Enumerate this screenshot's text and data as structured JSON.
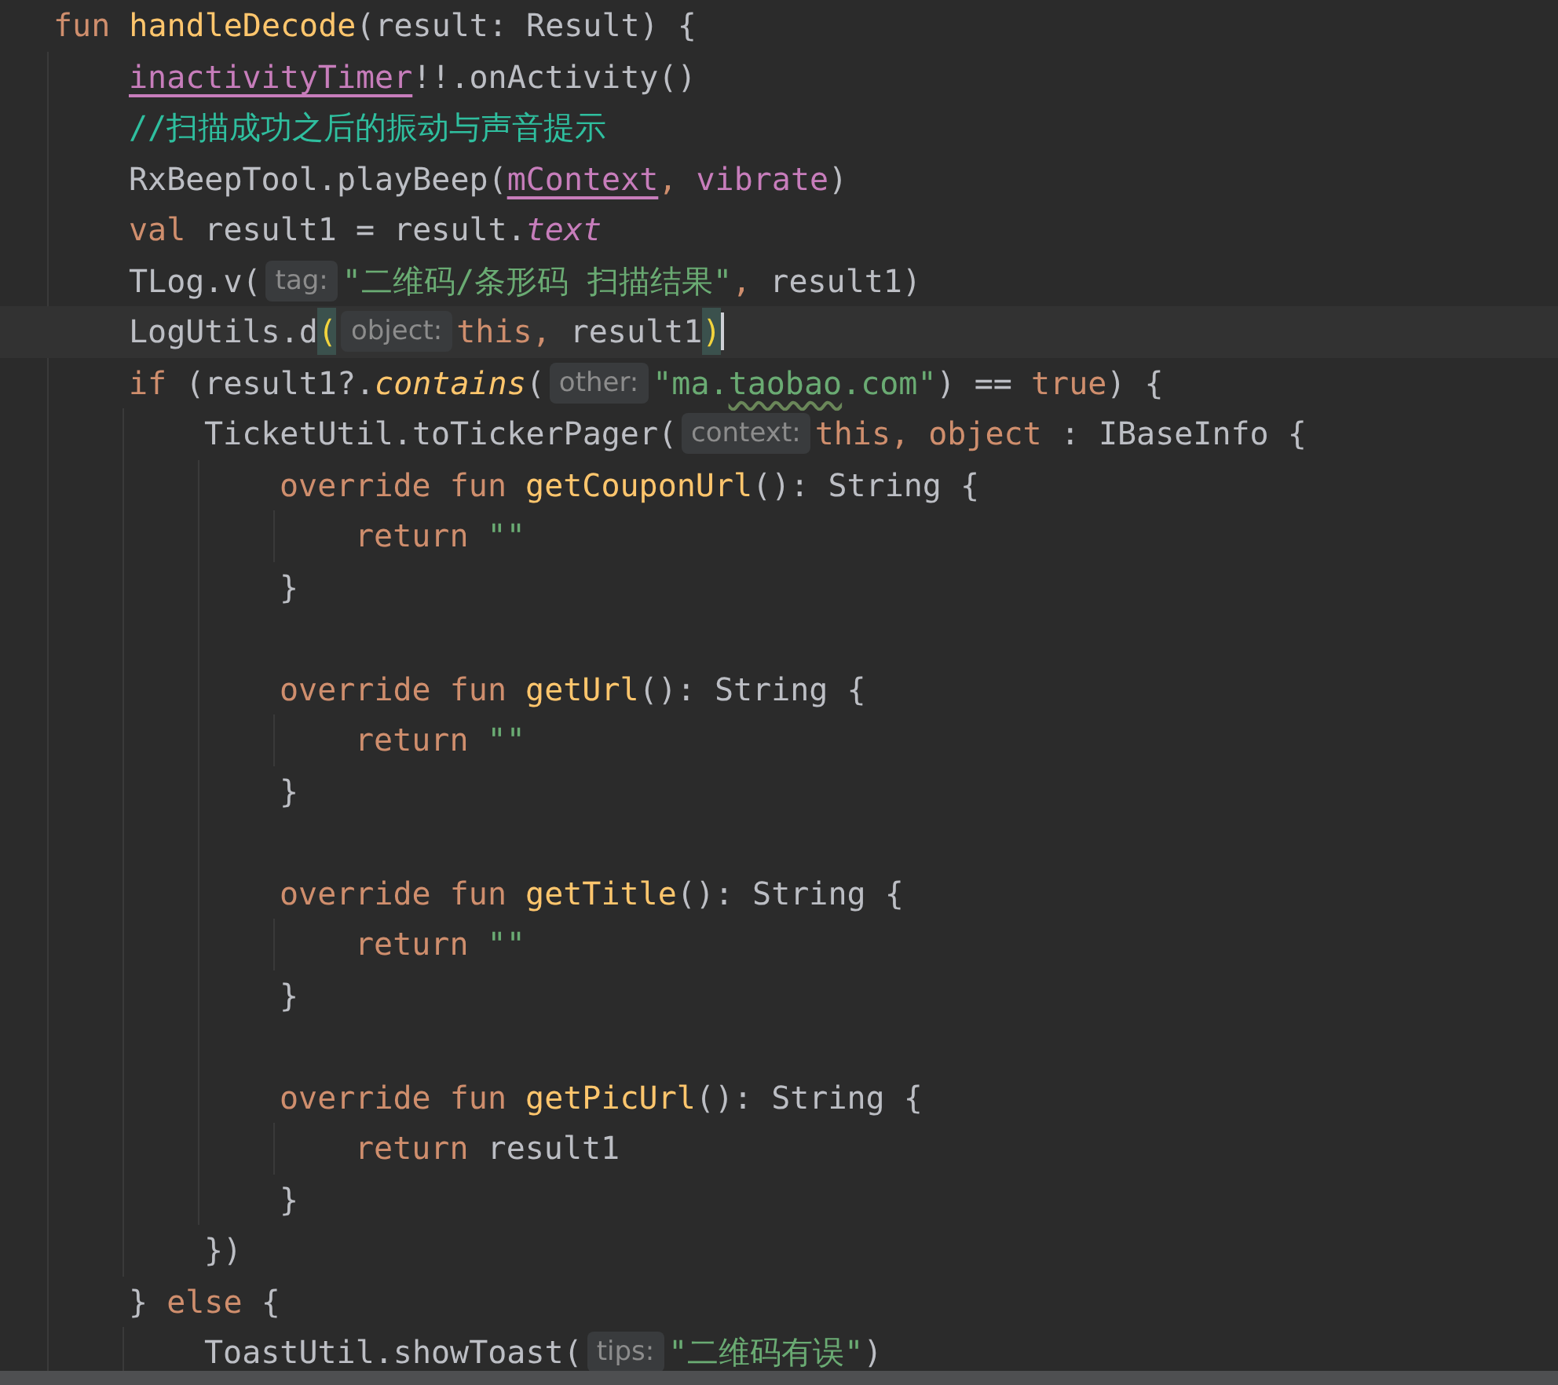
{
  "editor": {
    "lines": [
      {
        "kind": "code",
        "tokens": [
          {
            "t": "fun ",
            "kind": "keyword"
          },
          {
            "t": "handleDecode",
            "kind": "function"
          },
          {
            "t": "(result: Result) {",
            "kind": "plain"
          }
        ],
        "children": [
          {
            "kind": "code",
            "tokens": [
              {
                "t": "inactivityTimer",
                "kind": "link"
              },
              {
                "t": "!!.onActivity()",
                "kind": "plain"
              }
            ]
          },
          {
            "kind": "code",
            "tokens": [
              {
                "t": "//扫描成功之后的振动与声音提示",
                "kind": "comment"
              }
            ]
          },
          {
            "kind": "code",
            "tokens": [
              {
                "t": "RxBeepTool.playBeep(",
                "kind": "plain"
              },
              {
                "t": "mContext",
                "kind": "link"
              },
              {
                "t": ", ",
                "kind": "keyword"
              },
              {
                "t": "vibrate",
                "kind": "property"
              },
              {
                "t": ")",
                "kind": "plain"
              }
            ]
          },
          {
            "kind": "code",
            "tokens": [
              {
                "t": "val ",
                "kind": "keyword"
              },
              {
                "t": "result1 = result.",
                "kind": "plain"
              },
              {
                "t": "text",
                "kind": "extension"
              }
            ]
          },
          {
            "kind": "code",
            "tokens": [
              {
                "t": "TLog.v(",
                "kind": "plain"
              },
              {
                "t": "tag:",
                "kind": "hint"
              },
              {
                "t": "\"二维码/条形码 扫描结果\"",
                "kind": "string"
              },
              {
                "t": ", ",
                "kind": "keyword"
              },
              {
                "t": "result1)",
                "kind": "plain"
              }
            ]
          },
          {
            "kind": "code",
            "current": true,
            "tokens": [
              {
                "t": "LogUtils.d",
                "kind": "plain"
              },
              {
                "t": "(",
                "kind": "brace"
              },
              {
                "t": "object:",
                "kind": "hint"
              },
              {
                "t": "this, ",
                "kind": "keyword"
              },
              {
                "t": "result1",
                "kind": "plain"
              },
              {
                "t": ")",
                "kind": "brace"
              }
            ]
          },
          {
            "kind": "code",
            "tokens": [
              {
                "t": "if ",
                "kind": "keyword"
              },
              {
                "t": "(result1?.",
                "kind": "plain"
              },
              {
                "t": "contains",
                "kind": "call"
              },
              {
                "t": "(",
                "kind": "plain"
              },
              {
                "t": "other:",
                "kind": "hint"
              },
              {
                "t": "\"ma.",
                "kind": "string"
              },
              {
                "t": "taobao",
                "kind": "typo"
              },
              {
                "t": ".com\"",
                "kind": "string"
              },
              {
                "t": ") == ",
                "kind": "plain"
              },
              {
                "t": "true",
                "kind": "keyword"
              },
              {
                "t": ") {",
                "kind": "plain"
              }
            ],
            "children": [
              {
                "kind": "code",
                "tokens": [
                  {
                    "t": "TicketUtil.toTickerPager(",
                    "kind": "plain"
                  },
                  {
                    "t": "context:",
                    "kind": "hint"
                  },
                  {
                    "t": "this, object ",
                    "kind": "keyword"
                  },
                  {
                    "t": ": IBaseInfo {",
                    "kind": "plain"
                  }
                ],
                "children": [
                  {
                    "kind": "code",
                    "tokens": [
                      {
                        "t": "override fun ",
                        "kind": "keyword"
                      },
                      {
                        "t": "getCouponUrl",
                        "kind": "function"
                      },
                      {
                        "t": "(): String {",
                        "kind": "plain"
                      }
                    ],
                    "children": [
                      {
                        "kind": "code",
                        "tokens": [
                          {
                            "t": "return ",
                            "kind": "keyword"
                          },
                          {
                            "t": "\"\"",
                            "kind": "string"
                          }
                        ]
                      }
                    ]
                  },
                  {
                    "kind": "code",
                    "tokens": [
                      {
                        "t": "}",
                        "kind": "plain"
                      }
                    ]
                  },
                  {
                    "kind": "blank"
                  },
                  {
                    "kind": "code",
                    "tokens": [
                      {
                        "t": "override fun ",
                        "kind": "keyword"
                      },
                      {
                        "t": "getUrl",
                        "kind": "function"
                      },
                      {
                        "t": "(): String {",
                        "kind": "plain"
                      }
                    ],
                    "children": [
                      {
                        "kind": "code",
                        "tokens": [
                          {
                            "t": "return ",
                            "kind": "keyword"
                          },
                          {
                            "t": "\"\"",
                            "kind": "string"
                          }
                        ]
                      }
                    ]
                  },
                  {
                    "kind": "code",
                    "tokens": [
                      {
                        "t": "}",
                        "kind": "plain"
                      }
                    ]
                  },
                  {
                    "kind": "blank"
                  },
                  {
                    "kind": "code",
                    "tokens": [
                      {
                        "t": "override fun ",
                        "kind": "keyword"
                      },
                      {
                        "t": "getTitle",
                        "kind": "function"
                      },
                      {
                        "t": "(): String {",
                        "kind": "plain"
                      }
                    ],
                    "children": [
                      {
                        "kind": "code",
                        "tokens": [
                          {
                            "t": "return ",
                            "kind": "keyword"
                          },
                          {
                            "t": "\"\"",
                            "kind": "string"
                          }
                        ]
                      }
                    ]
                  },
                  {
                    "kind": "code",
                    "tokens": [
                      {
                        "t": "}",
                        "kind": "plain"
                      }
                    ]
                  },
                  {
                    "kind": "blank"
                  },
                  {
                    "kind": "code",
                    "tokens": [
                      {
                        "t": "override fun ",
                        "kind": "keyword"
                      },
                      {
                        "t": "getPicUrl",
                        "kind": "function"
                      },
                      {
                        "t": "(): String {",
                        "kind": "plain"
                      }
                    ],
                    "children": [
                      {
                        "kind": "code",
                        "tokens": [
                          {
                            "t": "return ",
                            "kind": "keyword"
                          },
                          {
                            "t": "result1",
                            "kind": "plain"
                          }
                        ]
                      }
                    ]
                  },
                  {
                    "kind": "code",
                    "tokens": [
                      {
                        "t": "}",
                        "kind": "plain"
                      }
                    ]
                  }
                ]
              },
              {
                "kind": "code",
                "tokens": [
                  {
                    "t": "})",
                    "kind": "plain"
                  }
                ]
              }
            ]
          },
          {
            "kind": "code",
            "tokens": [
              {
                "t": "} ",
                "kind": "plain"
              },
              {
                "t": "else ",
                "kind": "keyword"
              },
              {
                "t": "{",
                "kind": "plain"
              }
            ],
            "children": [
              {
                "kind": "code",
                "tokens": [
                  {
                    "t": "ToastUtil.showToast(",
                    "kind": "plain"
                  },
                  {
                    "t": "tips:",
                    "kind": "hint"
                  },
                  {
                    "t": "\"二维码有误\"",
                    "kind": "string"
                  },
                  {
                    "t": ")",
                    "kind": "plain"
                  }
                ]
              }
            ]
          }
        ]
      }
    ]
  }
}
